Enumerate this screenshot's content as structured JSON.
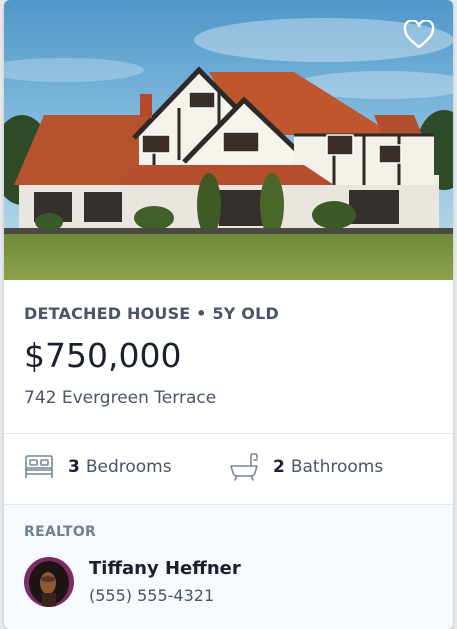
{
  "listing": {
    "type_label": "DETACHED HOUSE • 5Y OLD",
    "price": "$750,000",
    "address": "742 Evergreen Terrace",
    "photo_icon": "house-photo",
    "favorite_icon": "heart-icon"
  },
  "features": {
    "bedrooms": {
      "count": "3",
      "label": "Bedrooms",
      "icon": "bed-icon"
    },
    "bathrooms": {
      "count": "2",
      "label": "Bathrooms",
      "icon": "bathtub-icon"
    }
  },
  "realtor": {
    "section_label": "REALTOR",
    "name": "Tiffany Heffner",
    "phone": "(555) 555-4321",
    "avatar_icon": "avatar"
  },
  "colors": {
    "heading": "#4a5568",
    "price": "#1a202c",
    "muted": "#718096",
    "footer_bg": "#f7fafc"
  }
}
